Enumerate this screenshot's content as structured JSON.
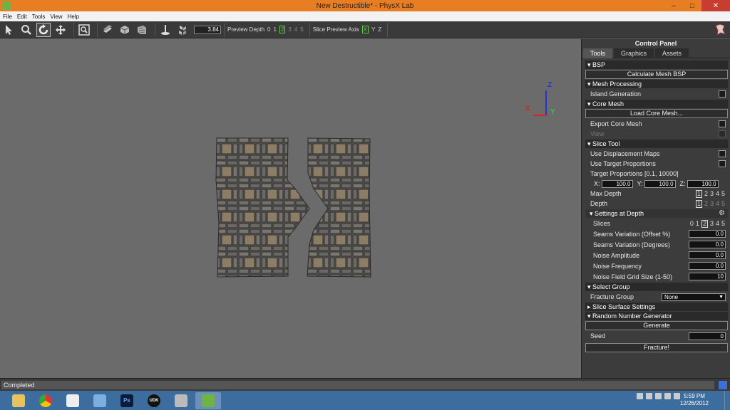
{
  "window": {
    "title": "New Destructible* - PhysX Lab",
    "minimize": "–",
    "maximize": "□",
    "close": "✕"
  },
  "menu": [
    "File",
    "Edit",
    "Tools",
    "View",
    "Help"
  ],
  "toolbar": {
    "value": "3.84",
    "preview_depth_label": "Preview Depth",
    "preview_depth_options": [
      "0",
      "1",
      "2",
      "3",
      "4",
      "5"
    ],
    "preview_depth_selected": "2",
    "slice_axis_label": "Slice Preview Axis",
    "slice_axis_options": [
      "X",
      "Y",
      "Z"
    ],
    "slice_axis_selected": "X"
  },
  "viewport": {
    "axis_z": "Z",
    "axis_x": "X",
    "axis_y": "Y"
  },
  "panel": {
    "title": "Control Panel",
    "tabs": [
      "Tools",
      "Graphics",
      "Assets"
    ],
    "active_tab": "Tools",
    "bsp": {
      "header": "▾ BSP",
      "button": "Calculate Mesh BSP"
    },
    "mesh_processing": {
      "header": "▾ Mesh Processing",
      "island_generation": "Island Generation"
    },
    "core_mesh": {
      "header": "▾ Core Mesh",
      "load_button": "Load Core Mesh...",
      "export": "Export Core Mesh",
      "view": "View"
    },
    "slice_tool": {
      "header": "▾ Slice Tool",
      "use_displacement": "Use Displacement Maps",
      "use_target": "Use Target Proportions",
      "target_label": "Target Proportions [0.1, 10000]",
      "x_label": "X:",
      "x_value": "100.0",
      "y_label": "Y:",
      "y_value": "100.0",
      "z_label": "Z:",
      "z_value": "100.0",
      "max_depth_label": "Max Depth",
      "max_depth_options": [
        "1",
        "2",
        "3",
        "4",
        "5"
      ],
      "depth_label": "Depth",
      "depth_options": [
        "1",
        "2",
        "3",
        "4",
        "5"
      ]
    },
    "settings_at_depth": {
      "header": "▾ Settings at Depth",
      "slices_label": "Slices",
      "slices_options": [
        "0",
        "1",
        "2",
        "3",
        "4",
        "5"
      ],
      "seams_offset_label": "Seams Variation (Offset %)",
      "seams_offset_value": "0.0",
      "seams_degrees_label": "Seams Variation (Degrees)",
      "seams_degrees_value": "0.0",
      "noise_amp_label": "Noise Amplitude",
      "noise_amp_value": "0.0",
      "noise_freq_label": "Noise Frequency",
      "noise_freq_value": "0.0",
      "noise_grid_label": "Noise Field Grid Size (1-50)",
      "noise_grid_value": "10"
    },
    "select_group": {
      "header": "▾ Select Group",
      "fracture_group_label": "Fracture Group",
      "fracture_group_value": "None"
    },
    "slice_surface": {
      "header": "▸ Slice Surface Settings"
    },
    "rng": {
      "header": "▾ Random Number Generator",
      "generate_button": "Generate",
      "seed_label": "Seed",
      "seed_value": "0"
    },
    "fracture_button": "Fracture!"
  },
  "status": {
    "text": "Completed"
  },
  "taskbar": {
    "apps": [
      "Explorer",
      "Chrome",
      "Files",
      "Remote",
      "Ps",
      "UDK",
      "Mail",
      "PhysX Lab"
    ],
    "ps_label": "Ps",
    "udk_label": "UDK",
    "time": "5:59 PM",
    "date": "12/26/2012"
  },
  "colors": {
    "title_bar": "#e87e24",
    "accent_green": "#5ccf3e",
    "taskbar": "#3d6d9e"
  }
}
